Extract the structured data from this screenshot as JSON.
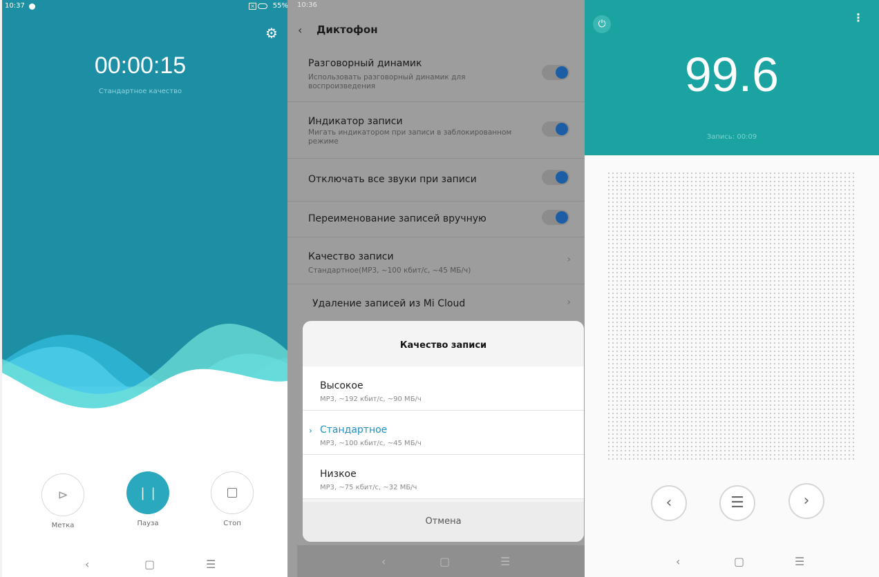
{
  "recorder": {
    "status_time": "10:37",
    "battery": "55%",
    "timer": "00:00:15",
    "quality": "Стандартное качество",
    "controls": {
      "mark": "Метка",
      "pause": "Пауза",
      "stop": "Стоп"
    },
    "nav": {
      "back": "‹",
      "home": "▢",
      "menu": "☰"
    }
  },
  "settings": {
    "status_time": "10:36",
    "title": "Диктофон",
    "rows": [
      {
        "title": "Разговорный динамик",
        "desc": "Использовать разговорный динамик для воспроизведения",
        "toggle": true
      },
      {
        "title": "Индикатор записи",
        "desc": "Мигать индикатором при записи в заблокированном режиме",
        "toggle": true
      },
      {
        "title": "Отключать все звуки при записи",
        "toggle": true
      },
      {
        "title": "Переименование записей вручную",
        "toggle": true
      },
      {
        "title": "Качество записи",
        "desc": "Стандартное(MP3, ~100 кбит/с, ~45 МБ/ч)"
      },
      {
        "title": "Удаление записей из Mi Cloud"
      }
    ],
    "sheet": {
      "title": "Качество записи",
      "options": [
        {
          "name": "Высокое",
          "spec": "MP3, ~192 кбит/с, ~90 МБ/ч"
        },
        {
          "name": "Стандартное",
          "spec": "MP3, ~100 кбит/с, ~45 МБ/ч",
          "selected": true
        },
        {
          "name": "Низкое",
          "spec": "MP3, ~75 кбит/с, ~32 МБ/ч"
        }
      ],
      "cancel": "Отмена"
    }
  },
  "radio": {
    "frequency": "99.6",
    "recording": "Запись: 00:09",
    "accent": "#1aa3a0"
  }
}
